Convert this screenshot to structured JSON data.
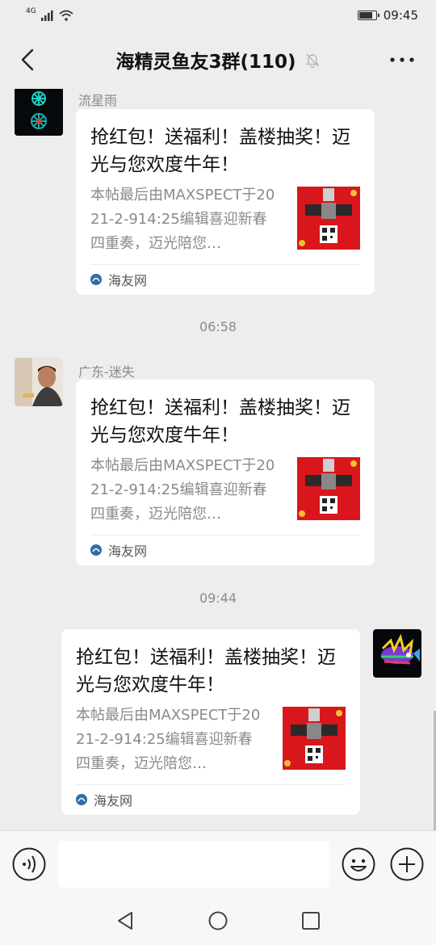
{
  "status_bar": {
    "network": "4G",
    "time": "09:45"
  },
  "header": {
    "title": "海精灵鱼友3群(110)"
  },
  "messages": [
    {
      "sender": "流星雨",
      "card_title": "抢红包！送福利！盖楼抽奖！迈光与您欢度牛年！",
      "card_desc": "本帖最后由MAXSPECT于2021-2-914:25编辑喜迎新春四重奏，迈光陪您…",
      "source": "海友网"
    },
    {
      "time": "06:58"
    },
    {
      "sender": "广东-迷失",
      "card_title": "抢红包！送福利！盖楼抽奖！迈光与您欢度牛年！",
      "card_desc": "本帖最后由MAXSPECT于2021-2-914:25编辑喜迎新春四重奏，迈光陪您…",
      "source": "海友网"
    },
    {
      "time": "09:44"
    },
    {
      "sender": "",
      "card_title": "抢红包！送福利！盖楼抽奖！迈光与您欢度牛年！",
      "card_desc": "本帖最后由MAXSPECT于2021-2-914:25编辑喜迎新春四重奏，迈光陪您…",
      "source": "海友网"
    }
  ],
  "input": {
    "value": ""
  },
  "colors": {
    "background": "#ededed",
    "card": "#ffffff",
    "secondary_text": "#8a8a8a",
    "thumb_red": "#d9161c"
  }
}
